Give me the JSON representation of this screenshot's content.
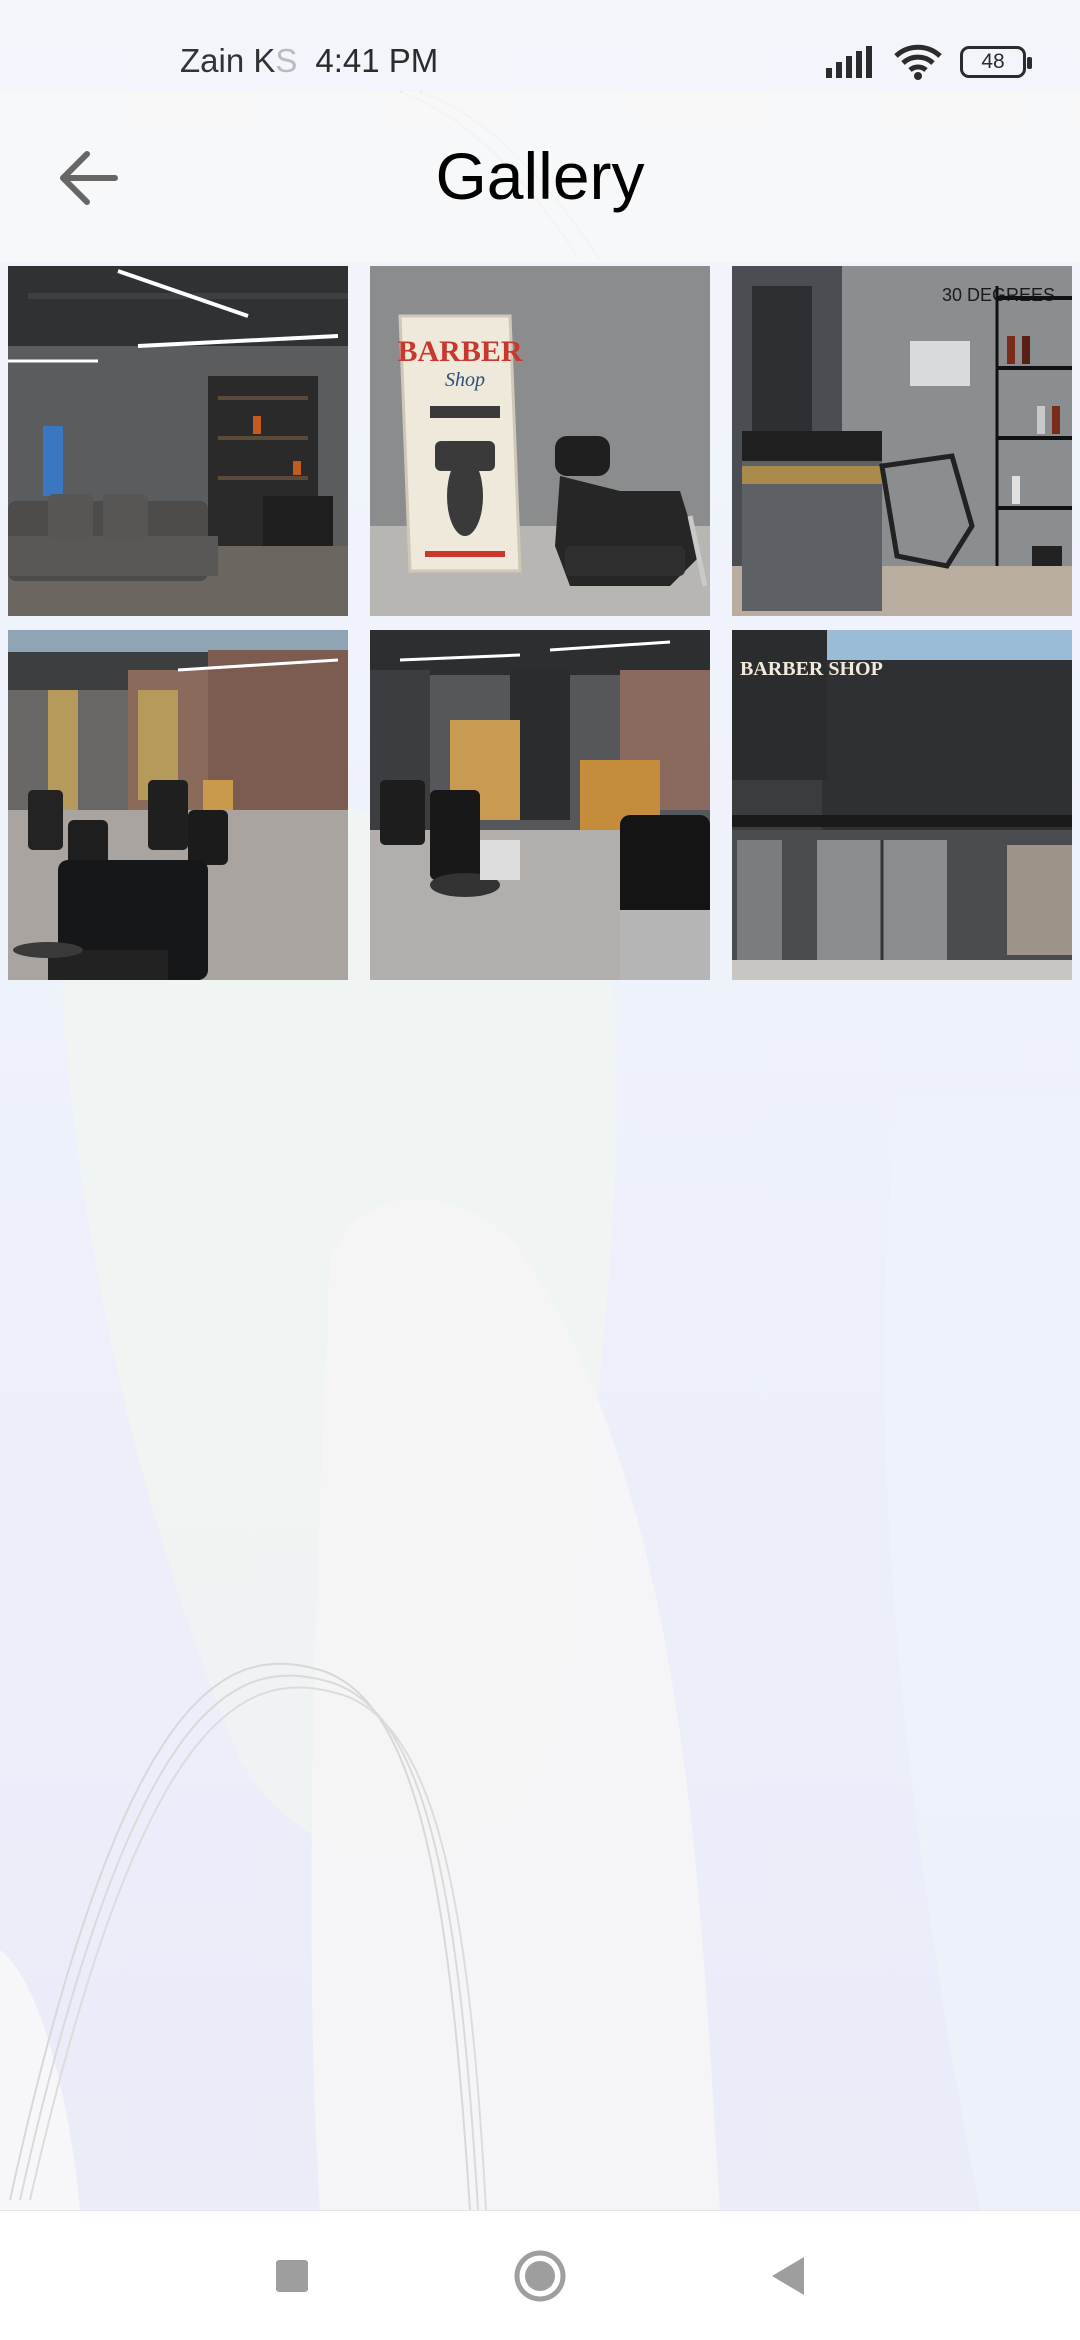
{
  "status_bar": {
    "carrier_visible": "Zain K",
    "carrier_faded": "S",
    "time": "4:41 PM",
    "battery_level": "48",
    "icons": [
      "signal-icon",
      "wifi-icon",
      "battery-icon"
    ]
  },
  "header": {
    "title": "Gallery",
    "back_icon": "arrow-left-icon"
  },
  "gallery": {
    "columns": 3,
    "images": [
      {
        "scene": "salon-lounge-sofa"
      },
      {
        "scene": "barber-shop-poster-wash-chair"
      },
      {
        "scene": "reception-product-shelves"
      },
      {
        "scene": "barber-chairs-row"
      },
      {
        "scene": "barber-stations-mirrors"
      },
      {
        "scene": "storefront-exterior"
      }
    ],
    "poster_text": {
      "barber": "BARBER",
      "shop": "Shop"
    },
    "sign_text": {
      "degrees": "30 DEGREES",
      "storefront": "BARBER SHOP"
    }
  },
  "nav_bar": {
    "icons": [
      "recents-square-icon",
      "home-circle-icon",
      "back-triangle-icon"
    ]
  },
  "colors": {
    "background": "#eef2fb",
    "title": "#000000",
    "icon": "#666666",
    "nav_icon": "#9e9e9e"
  }
}
